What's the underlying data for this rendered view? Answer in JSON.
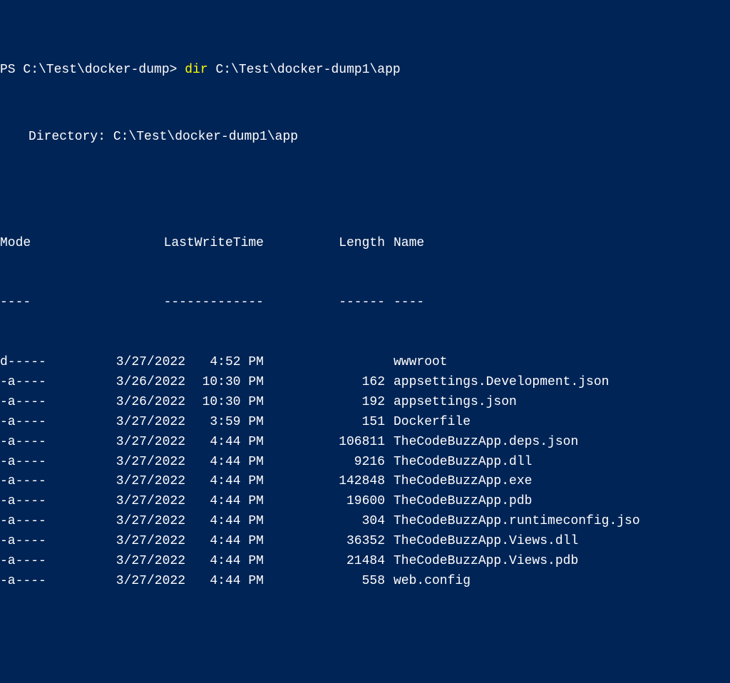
{
  "prompt": {
    "prefix": "PS C:\\Test\\docker-dump> ",
    "command": "dir",
    "argument": " C:\\Test\\docker-dump1\\app"
  },
  "directory_label": "Directory: C:\\Test\\docker-dump1\\app",
  "headers": {
    "mode": "Mode",
    "lastwrite": "LastWriteTime",
    "length": "Length",
    "name": "Name"
  },
  "underlines": {
    "mode": "----",
    "lastwrite": "-------------",
    "length": "------",
    "name": "----"
  },
  "rows": [
    {
      "mode": "d-----",
      "date": "3/27/2022",
      "time": "4:52 PM",
      "length": "",
      "name": "wwwroot"
    },
    {
      "mode": "-a----",
      "date": "3/26/2022",
      "time": "10:30 PM",
      "length": "162",
      "name": "appsettings.Development.json"
    },
    {
      "mode": "-a----",
      "date": "3/26/2022",
      "time": "10:30 PM",
      "length": "192",
      "name": "appsettings.json"
    },
    {
      "mode": "-a----",
      "date": "3/27/2022",
      "time": "3:59 PM",
      "length": "151",
      "name": "Dockerfile"
    },
    {
      "mode": "-a----",
      "date": "3/27/2022",
      "time": "4:44 PM",
      "length": "106811",
      "name": "TheCodeBuzzApp.deps.json"
    },
    {
      "mode": "-a----",
      "date": "3/27/2022",
      "time": "4:44 PM",
      "length": "9216",
      "name": "TheCodeBuzzApp.dll"
    },
    {
      "mode": "-a----",
      "date": "3/27/2022",
      "time": "4:44 PM",
      "length": "142848",
      "name": "TheCodeBuzzApp.exe"
    },
    {
      "mode": "-a----",
      "date": "3/27/2022",
      "time": "4:44 PM",
      "length": "19600",
      "name": "TheCodeBuzzApp.pdb"
    },
    {
      "mode": "-a----",
      "date": "3/27/2022",
      "time": "4:44 PM",
      "length": "304",
      "name": "TheCodeBuzzApp.runtimeconfig.jso"
    },
    {
      "mode": "-a----",
      "date": "3/27/2022",
      "time": "4:44 PM",
      "length": "36352",
      "name": "TheCodeBuzzApp.Views.dll"
    },
    {
      "mode": "-a----",
      "date": "3/27/2022",
      "time": "4:44 PM",
      "length": "21484",
      "name": "TheCodeBuzzApp.Views.pdb"
    },
    {
      "mode": "-a----",
      "date": "3/27/2022",
      "time": "4:44 PM",
      "length": "558",
      "name": "web.config"
    }
  ]
}
